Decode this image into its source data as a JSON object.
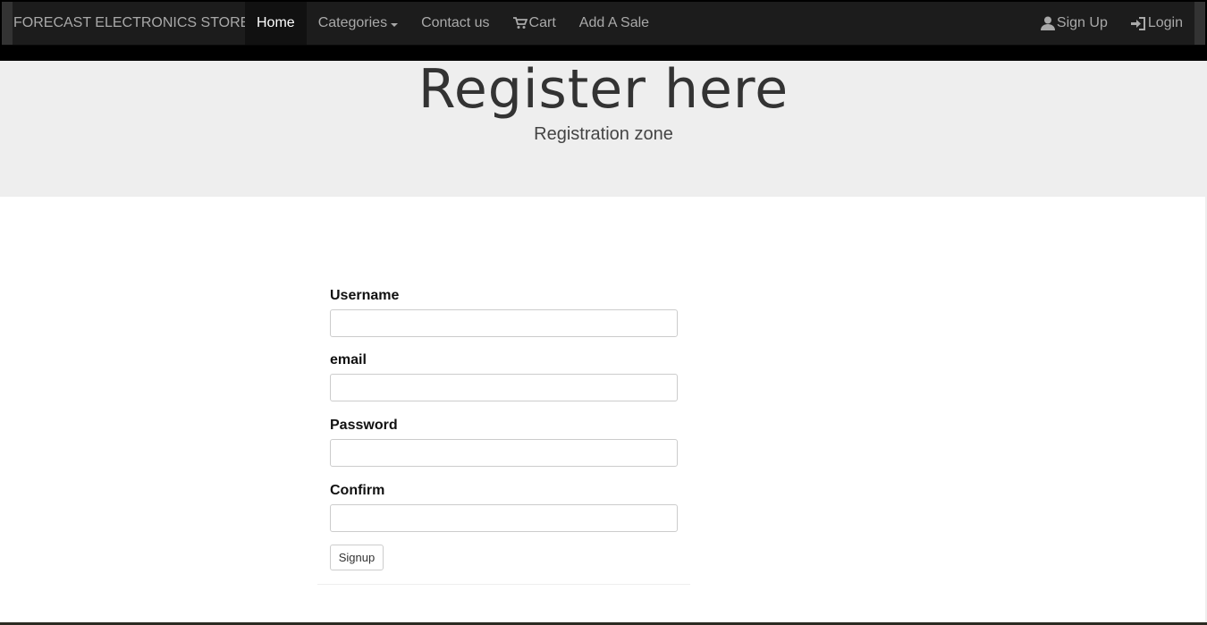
{
  "navbar": {
    "brand": "FORECAST ELECTRONICS STORE",
    "left_items": [
      {
        "label": "Home",
        "active": true
      },
      {
        "label": "Categories"
      },
      {
        "label": "Contact us"
      },
      {
        "label": "Cart",
        "icon": "cart-icon"
      },
      {
        "label": "Add A Sale"
      }
    ],
    "right_items": [
      {
        "label": "Sign Up",
        "icon": "user-icon"
      },
      {
        "label": "Login",
        "icon": "login-icon"
      }
    ]
  },
  "jumbotron": {
    "title": "Register here",
    "subtitle": "Registration zone"
  },
  "form": {
    "username_label": "Username",
    "username_value": "",
    "email_label": "email",
    "email_value": "",
    "password_label": "Password",
    "password_value": "",
    "confirm_label": "Confirm",
    "confirm_value": "",
    "submit_label": "Signup"
  },
  "colors": {
    "navbar_bg": "#1c1c1c",
    "jumbotron_bg": "#eeeeee"
  }
}
